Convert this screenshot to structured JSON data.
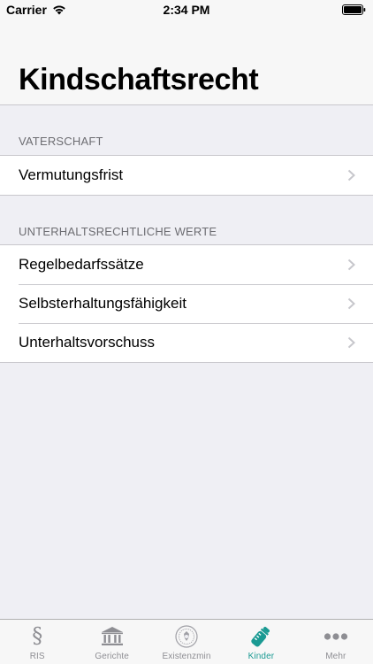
{
  "status_bar": {
    "carrier": "Carrier",
    "time": "2:34 PM"
  },
  "header": {
    "title": "Kindschaftsrecht"
  },
  "sections": [
    {
      "header": "VATERSCHAFT",
      "items": [
        "Vermutungsfrist"
      ]
    },
    {
      "header": "UNTERHALTSRECHTLICHE WERTE",
      "items": [
        "Regelbedarfssätze",
        "Selbsterhaltungsfähigkeit",
        "Unterhaltsvorschuss"
      ]
    }
  ],
  "tab_bar": {
    "active_tab": "Kinder",
    "active_color": "#1a9a93",
    "inactive_color": "#8e8e93",
    "tabs": [
      {
        "label": "RIS",
        "icon": "paragraph-icon"
      },
      {
        "label": "Gerichte",
        "icon": "courthouse-icon"
      },
      {
        "label": "Existenzmin",
        "icon": "seal-icon"
      },
      {
        "label": "Kinder",
        "icon": "baby-bottle-icon"
      },
      {
        "label": "Mehr",
        "icon": "more-dots-icon"
      }
    ]
  }
}
